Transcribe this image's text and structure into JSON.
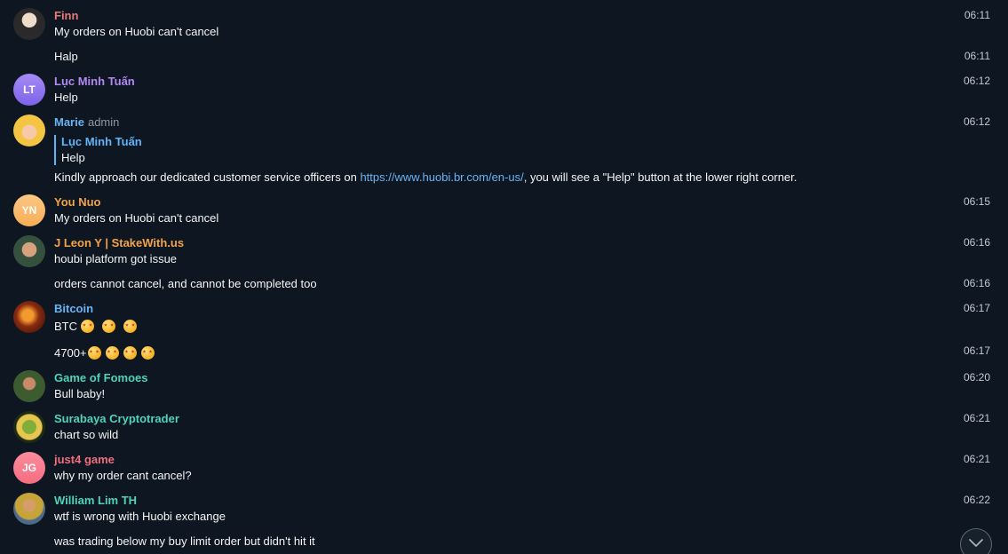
{
  "messages": [
    {
      "name": "Finn",
      "text": "My orders on Huobi can't cancel",
      "time": "06:11",
      "name_color": "#e87979",
      "avatar_icon": "person-photo"
    },
    {
      "text": "Halp",
      "time": "06:11"
    },
    {
      "name": "Lục Minh Tuấn",
      "text": "Help",
      "time": "06:12",
      "name_color": "#b18af0",
      "avatar_initials": "LT",
      "avatar_color": "#8f74f0"
    },
    {
      "name": "Marie",
      "role": "admin",
      "time": "06:12",
      "name_color": "#6ab3f3",
      "avatar_icon": "cartoon-face",
      "reply": {
        "name": "Lục Minh Tuấn",
        "text": "Help"
      },
      "text_before": "Kindly approach our dedicated customer service officers on ",
      "link": "https://www.huobi.br.com/en-us/",
      "text_after": ", you will see a \"Help\" button at the lower right corner."
    },
    {
      "name": "You Nuo",
      "text": "My orders on Huobi can't cancel",
      "time": "06:15",
      "name_color": "#f2a446",
      "avatar_initials": "YN",
      "avatar_color": "#fbbd73"
    },
    {
      "name": "J Leon Y | StakeWith.us",
      "text": "houbi platform got issue",
      "time": "06:16",
      "name_color": "#f2a446",
      "avatar_icon": "person-photo"
    },
    {
      "text": "orders cannot cancel, and cannot be completed too",
      "time": "06:16"
    },
    {
      "name": "Bitcoin",
      "text": "BTC",
      "emoji_count": 3,
      "time": "06:17",
      "name_color": "#6ab3f3",
      "avatar_icon": "bitcoin-logo"
    },
    {
      "text": "4700+",
      "emoji_count": 4,
      "time": "06:17"
    },
    {
      "name": "Game of Fomoes",
      "text": "Bull baby!",
      "time": "06:20",
      "name_color": "#4fd3ba",
      "avatar_icon": "person-photo"
    },
    {
      "name": "Surabaya Cryptotrader",
      "text": "chart so wild",
      "time": "06:21",
      "name_color": "#4fd3ba",
      "avatar_icon": "crest-logo"
    },
    {
      "name": "just4 game",
      "text": "why my order cant cancel?",
      "time": "06:21",
      "name_color": "#f06e7d",
      "avatar_initials": "JG",
      "avatar_color": "#f97d8f"
    },
    {
      "name": "William Lim TH",
      "text": "wtf is wrong with Huobi exchange",
      "time": "06:22",
      "name_color": "#4fd3ba",
      "avatar_icon": "person-photo"
    },
    {
      "text": "was trading below my buy limit order but didn't hit it"
    }
  ],
  "scroll_button": {
    "icon": "chevron-down-icon"
  },
  "emoji_icon": "star-struck-emoji"
}
